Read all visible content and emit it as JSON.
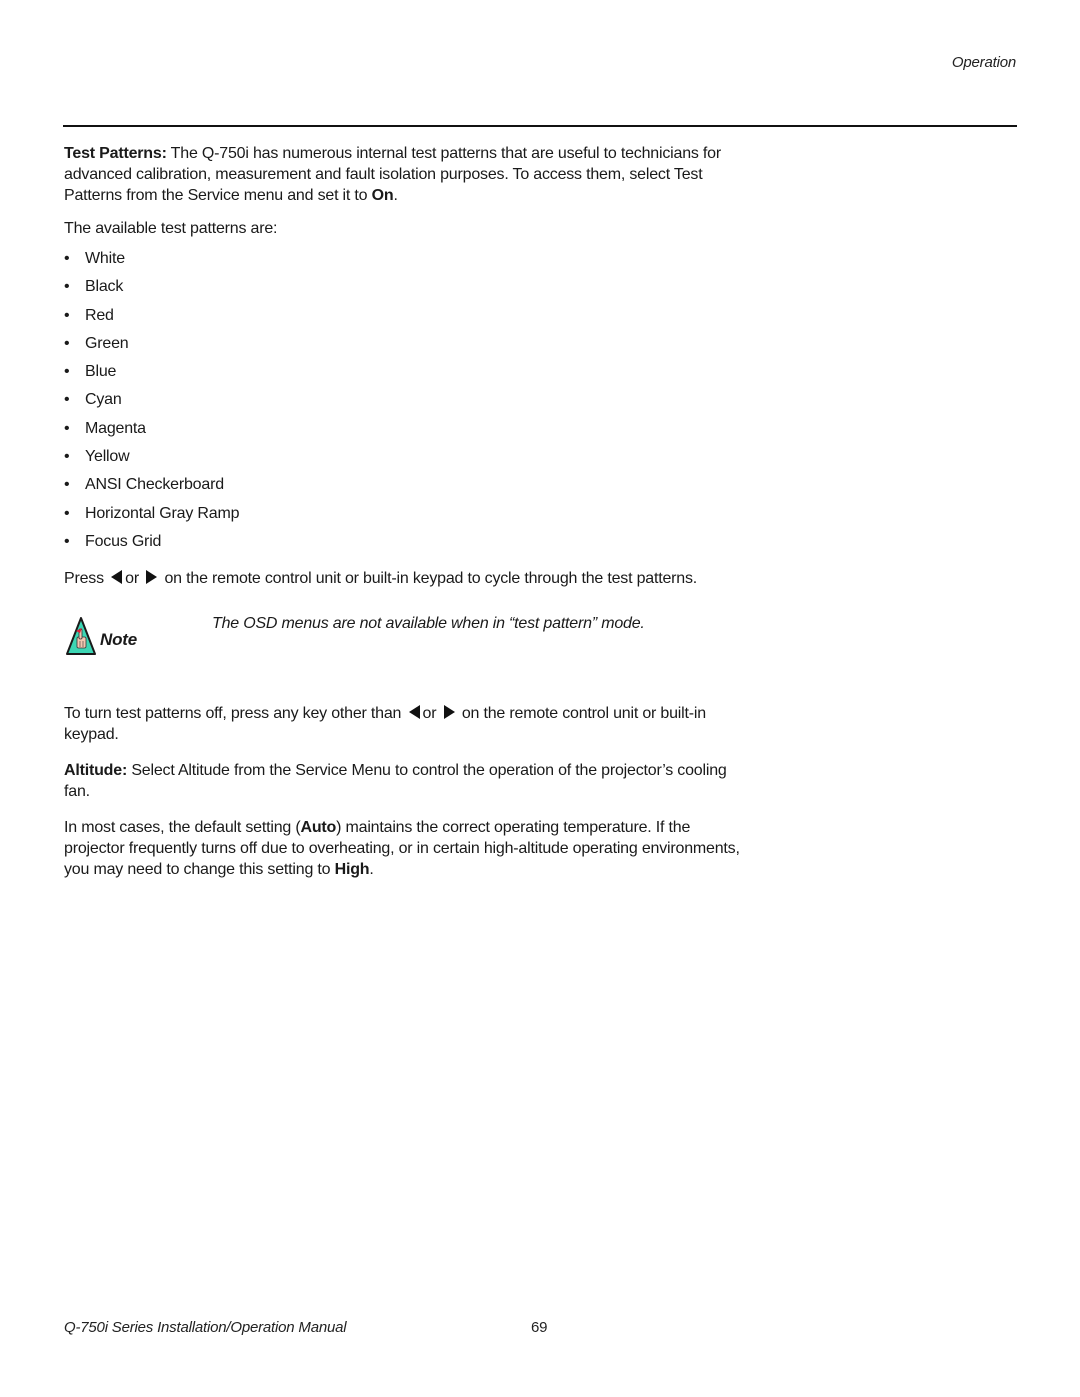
{
  "header": {
    "section": "Operation"
  },
  "test_patterns": {
    "heading": "Test Patterns:",
    "intro_text": " The Q-750i has numerous internal test patterns that are useful to technicians for advanced calibration, measurement and fault isolation purposes. To access them, select Test Patterns from the Service menu and set it to ",
    "intro_bold_end": "On",
    "intro_period": ".",
    "available_label": "The available test patterns are:",
    "bullet_glyph": "•",
    "patterns": [
      "White",
      "Black",
      "Red",
      "Green",
      "Blue",
      "Cyan",
      "Magenta",
      "Yellow",
      "ANSI Checkerboard",
      "Horizontal Gray Ramp",
      "Focus Grid"
    ],
    "press_prefix": "Press",
    "press_or": "or",
    "press_suffix": "on the remote control unit or built-in keypad to cycle through the test patterns.",
    "left_arrow_icon": "left-arrow-icon",
    "right_arrow_icon": "right-arrow-icon"
  },
  "note": {
    "icon": "note-hand-triangle-icon",
    "label": "Note",
    "text": "The OSD menus are not available when in “test pattern” mode.",
    "icon_colors": {
      "fill": "#3cd6b4",
      "outline": "#1a1a1a",
      "hand": "#f2c6b0",
      "accent": "#e0203a"
    }
  },
  "turn_off": {
    "prefix": "To turn test patterns off, press any key other than",
    "or": "or",
    "suffix": "on the remote control unit or built-in keypad."
  },
  "altitude": {
    "heading": "Altitude:",
    "text": " Select Altitude from the Service Menu to control the operation of the projector’s cooling fan.",
    "detail_prefix": "In most cases, the default setting (",
    "detail_bold_auto": "Auto",
    "detail_middle": ") maintains the correct operating temperature. If the projector frequently turns off due to overheating, or in certain high-altitude operating environments, you may need to change this setting to ",
    "detail_bold_high": "High",
    "detail_end": "."
  },
  "footer": {
    "title": "Q-750i Series Installation/Operation Manual",
    "page_number": "69"
  }
}
